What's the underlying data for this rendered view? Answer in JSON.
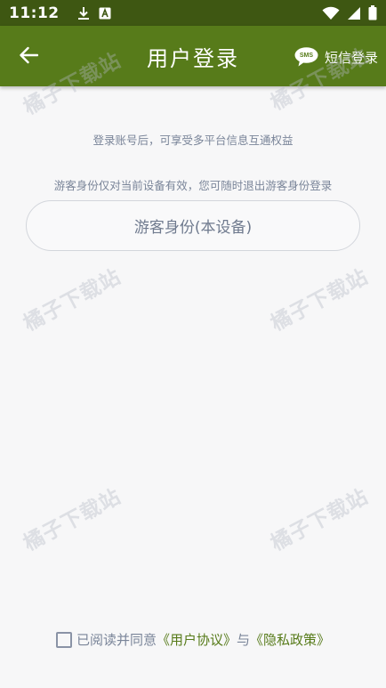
{
  "status_bar": {
    "time": "11:12",
    "icons": [
      "download-icon",
      "app-notification-icon",
      "wifi-icon",
      "signal-icon",
      "battery-icon"
    ]
  },
  "toolbar": {
    "back_icon": "arrow-left-icon",
    "title": "用户登录",
    "sms_badge": "SMS",
    "sms_label": "短信登录"
  },
  "main": {
    "login_benefit": "登录账号后，可享受多平台信息互通权益",
    "guest_hint": "游客身份仅对当前设备有效，您可随时退出游客身份登录",
    "guest_button": "游客身份(本设备)"
  },
  "agreement": {
    "checked": false,
    "prefix": "已阅读并同意",
    "user_agreement": "《用户协议》",
    "conjunction": "与",
    "privacy_policy": "《隐私政策》"
  },
  "watermark": {
    "text": "橘子下载站"
  },
  "colors": {
    "status_bar": "#3e5712",
    "toolbar": "#577b1a",
    "background": "#f7f7f8",
    "muted_text": "#7a8599",
    "link": "#577b1a"
  }
}
